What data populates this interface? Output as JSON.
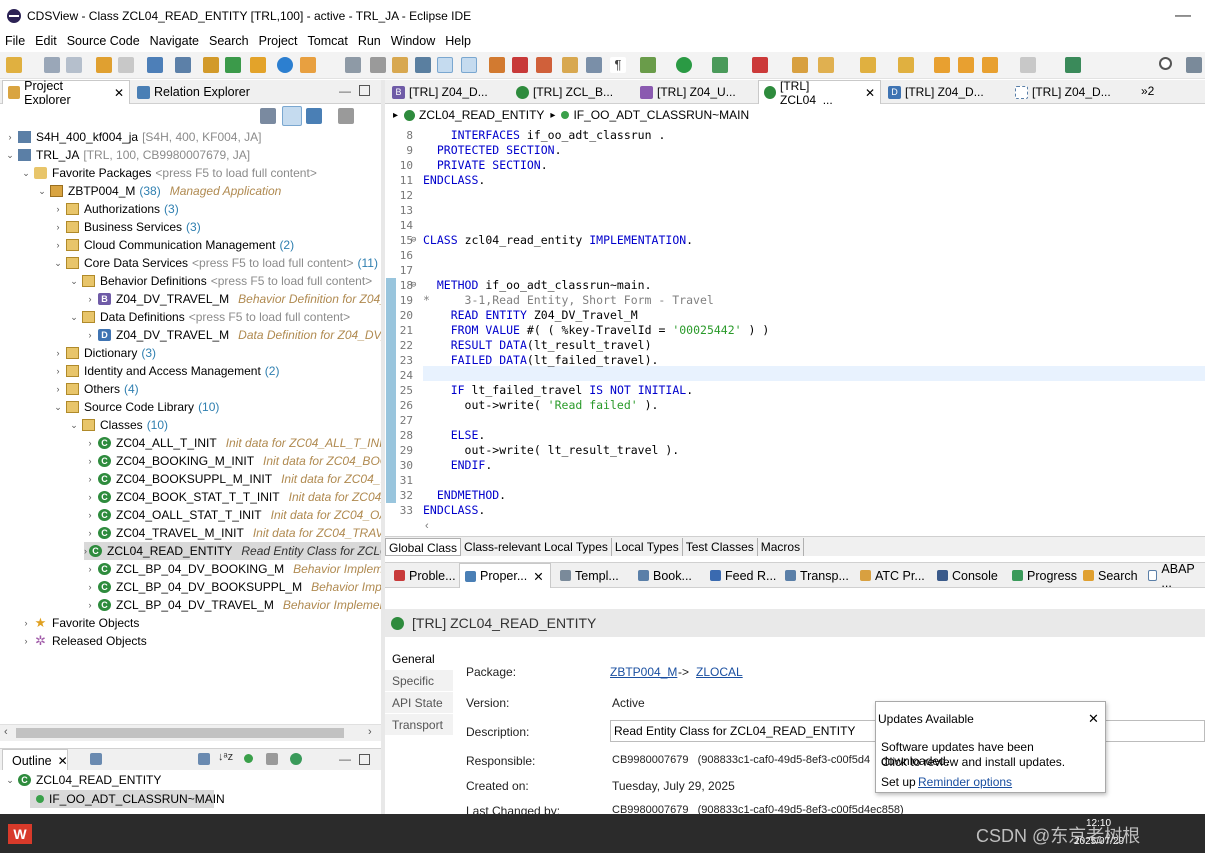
{
  "window": {
    "title": "CDSView - Class ZCL04_READ_ENTITY [TRL,100] - active - TRL_JA - Eclipse IDE",
    "minimize": "—",
    "close": "✕"
  },
  "menu": [
    "File",
    "Edit",
    "Source Code",
    "Navigate",
    "Search",
    "Project",
    "Tomcat",
    "Run",
    "Window",
    "Help"
  ],
  "left_views": {
    "project_explorer": "Project Explorer",
    "relation_explorer": "Relation Explorer"
  },
  "tree": {
    "s4h": {
      "label": "S4H_400_kf004_ja",
      "dec": "[S4H, 400, KF004, JA]"
    },
    "trl": {
      "label": "TRL_JA",
      "dec": "[TRL, 100, CB9980007679, JA]"
    },
    "fav_packages": {
      "label": "Favorite Packages",
      "dec": "<press F5 to load full content>"
    },
    "zbtp": {
      "label": "ZBTP004_M",
      "count": "(38)",
      "dec": "Managed Application"
    },
    "authorizations": {
      "label": "Authorizations",
      "count": "(3)"
    },
    "business_services": {
      "label": "Business Services",
      "count": "(3)"
    },
    "cloud_comm": {
      "label": "Cloud Communication Management",
      "count": "(2)"
    },
    "core_data": {
      "label": "Core Data Services",
      "dec": "<press F5 to load full content>",
      "count": "(11)"
    },
    "behavior_defs": {
      "label": "Behavior Definitions",
      "dec": "<press F5 to load full content>"
    },
    "bdef_item": {
      "label": "Z04_DV_TRAVEL_M",
      "dec": "Behavior Definition for Z04_D"
    },
    "data_defs": {
      "label": "Data Definitions",
      "dec": "<press F5 to load full content>"
    },
    "ddef_item": {
      "label": "Z04_DV_TRAVEL_M",
      "dec": "Data Definition for Z04_DV_T"
    },
    "dictionary": {
      "label": "Dictionary",
      "count": "(3)"
    },
    "iam": {
      "label": "Identity and Access Management",
      "count": "(2)"
    },
    "others": {
      "label": "Others",
      "count": "(4)"
    },
    "scl": {
      "label": "Source Code Library",
      "count": "(10)"
    },
    "classes": {
      "label": "Classes",
      "count": "(10)"
    },
    "class_items": [
      {
        "label": "ZC04_ALL_T_INIT",
        "dec": "Init data for ZC04_ALL_T_INIT"
      },
      {
        "label": "ZC04_BOOKING_M_INIT",
        "dec": "Init data for ZC04_BOOKI"
      },
      {
        "label": "ZC04_BOOKSUPPL_M_INIT",
        "dec": "Init data for ZC04_BO"
      },
      {
        "label": "ZC04_BOOK_STAT_T_T_INIT",
        "dec": "Init data for ZC04_BO"
      },
      {
        "label": "ZC04_OALL_STAT_T_INIT",
        "dec": "Init data for ZC04_OALL"
      },
      {
        "label": "ZC04_TRAVEL_M_INIT",
        "dec": "Init data for ZC04_TRAVEL_"
      },
      {
        "label": "ZCL04_READ_ENTITY",
        "dec": "Read Entity Class for ZCL04_"
      },
      {
        "label": "ZCL_BP_04_DV_BOOKING_M",
        "dec": "Behavior Implemen"
      },
      {
        "label": "ZCL_BP_04_DV_BOOKSUPPL_M",
        "dec": "Behavior Implem"
      },
      {
        "label": "ZCL_BP_04_DV_TRAVEL_M",
        "dec": "Behavior Implementat"
      }
    ],
    "fav_objects": {
      "label": "Favorite Objects"
    },
    "released_objects": {
      "label": "Released Objects"
    }
  },
  "outline": {
    "tab": "Outline",
    "class": "ZCL04_READ_ENTITY",
    "method": "IF_OO_ADT_CLASSRUN~MAIN"
  },
  "editor_tabs": [
    {
      "label": "[TRL] Z04_D...",
      "icon": "B"
    },
    {
      "label": "[TRL] ZCL_B...",
      "icon": "C"
    },
    {
      "label": "[TRL] Z04_U...",
      "icon": "S"
    },
    {
      "label": "[TRL] ZCL04_...",
      "icon": "C"
    },
    {
      "label": "[TRL] Z04_D...",
      "icon": "D"
    },
    {
      "label": "[TRL] Z04_D...",
      "icon": "M"
    }
  ],
  "editor_tabs_overflow": "»2",
  "breadcrumb": {
    "class": "ZCL04_READ_ENTITY",
    "method": "IF_OO_ADT_CLASSRUN~MAIN"
  },
  "code_lines": [
    {
      "n": "8",
      "t": "    INTERFACES if_oo_adt_classrun ."
    },
    {
      "n": "9",
      "t": "  PROTECTED SECTION."
    },
    {
      "n": "10",
      "t": "  PRIVATE SECTION."
    },
    {
      "n": "11",
      "t": "ENDCLASS."
    },
    {
      "n": "12",
      "t": ""
    },
    {
      "n": "13",
      "t": ""
    },
    {
      "n": "14",
      "t": ""
    },
    {
      "n": "15",
      "t": "CLASS zcl04_read_entity IMPLEMENTATION."
    },
    {
      "n": "16",
      "t": ""
    },
    {
      "n": "17",
      "t": ""
    },
    {
      "n": "18",
      "t": "  METHOD if_oo_adt_classrun~main."
    },
    {
      "n": "19",
      "t": "*     3-1,Read Entity, Short Form - Travel"
    },
    {
      "n": "20",
      "t": "    READ ENTITY Z04_DV_Travel_M"
    },
    {
      "n": "21",
      "t": "    FROM VALUE #( ( %key-TravelId = '00025442' ) )"
    },
    {
      "n": "22",
      "t": "    RESULT DATA(lt_result_travel)"
    },
    {
      "n": "23",
      "t": "    FAILED DATA(lt_failed_travel)."
    },
    {
      "n": "24",
      "t": ""
    },
    {
      "n": "25",
      "t": "    IF lt_failed_travel IS NOT INITIAL."
    },
    {
      "n": "26",
      "t": "      out->write( 'Read failed' )."
    },
    {
      "n": "27",
      "t": ""
    },
    {
      "n": "28",
      "t": "    ELSE."
    },
    {
      "n": "29",
      "t": "      out->write( lt_result_travel )."
    },
    {
      "n": "30",
      "t": "    ENDIF."
    },
    {
      "n": "31",
      "t": ""
    },
    {
      "n": "32",
      "t": "  ENDMETHOD."
    },
    {
      "n": "33",
      "t": "ENDCLASS."
    }
  ],
  "sub_tabs": [
    "Global Class",
    "Class-relevant Local Types",
    "Local Types",
    "Test Classes",
    "Macros"
  ],
  "bottom_tabs": [
    "Proble...",
    "Proper...",
    "Templ...",
    "Book...",
    "Feed R...",
    "Transp...",
    "ATC Pr...",
    "Console",
    "Progress",
    "Search",
    "ABAP ..."
  ],
  "properties": {
    "header": "[TRL] ZCL04_READ_ENTITY",
    "side_tabs": [
      "General",
      "Specific",
      "API State",
      "Transport"
    ],
    "package_label": "Package:",
    "package_link": "ZBTP004_M",
    "package_arrow": "->",
    "package_parent": "ZLOCAL",
    "version_label": "Version:",
    "version_value": "Active",
    "description_label": "Description:",
    "description_value": "Read Entity Class for ZCL04_READ_ENTITY",
    "responsible_label": "Responsible:",
    "responsible_value": "CB9980007679   (908833c1-caf0-49d5-8ef3-c00f5d4",
    "created_label": "Created on:",
    "created_value": "Tuesday, July 29, 2025",
    "changed_label": "Last Changed by:",
    "changed_value": "CB9980007679   (908833c1-caf0-49d5-8ef3-c00f5d4ec858)"
  },
  "popup": {
    "title": "Updates Available",
    "close": "✕",
    "line1": "Software updates have been downloaded.",
    "line2": "Click to review and install updates.",
    "setup_prefix": "Set up",
    "setup_link": "Reminder options"
  },
  "taskbar": {
    "time": "12:10",
    "date": "2025/07/29",
    "watermark": "CSDN @东京老树根"
  }
}
